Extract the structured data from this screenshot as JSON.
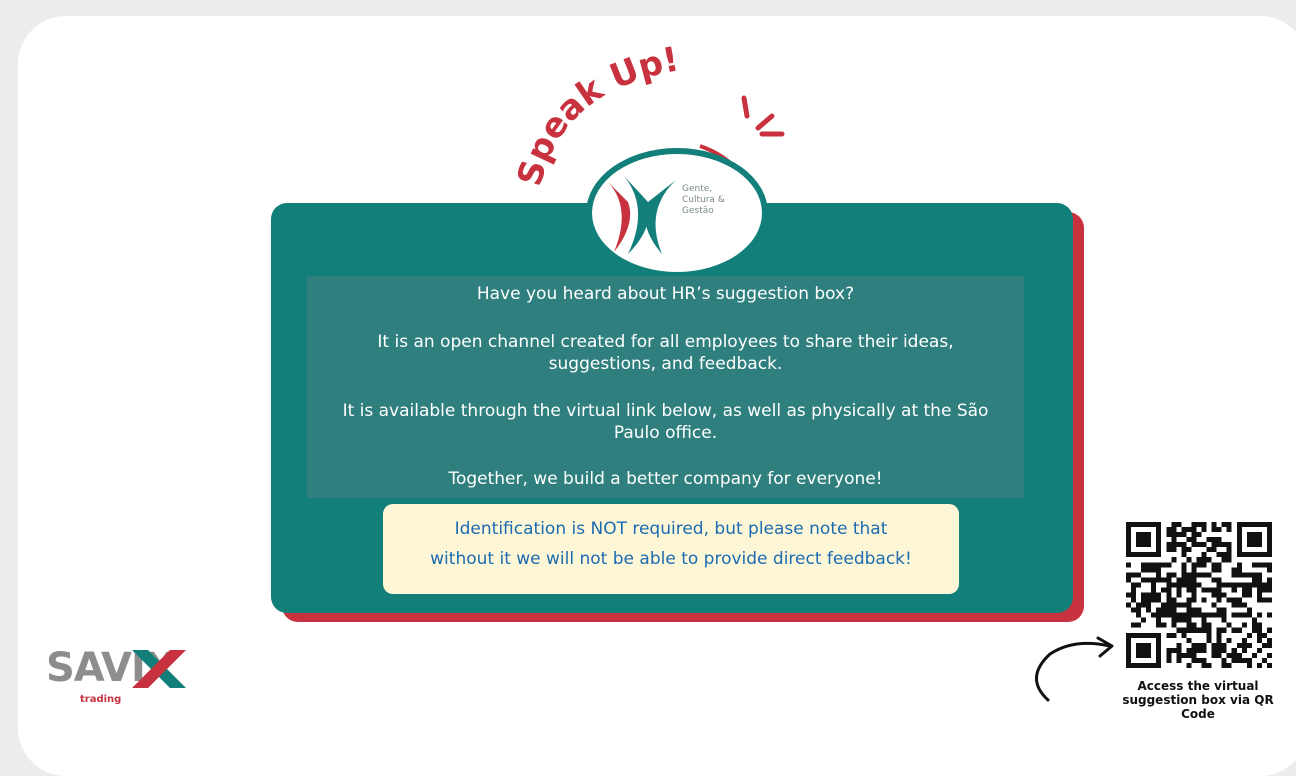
{
  "headline": "Speak Up!",
  "logo": {
    "line1": "Gente,",
    "line2": "Cultura &",
    "line3": "Gestão"
  },
  "message": {
    "p1": "Have you heard about HR’s suggestion box?",
    "p2": "It is an open channel created for all employees to share their ideas, suggestions, and feedback.",
    "p3": "It is available through the virtual link below, as well as physically at the São Paulo office.",
    "p4": "Together, we build a better company for everyone!"
  },
  "notice": {
    "line1": "Identification is NOT required, but please note that",
    "line2": "without it we will not be able to provide direct feedback!"
  },
  "brand": {
    "name": "SAVIX",
    "sub": "trading"
  },
  "qr": {
    "caption": "Access the virtual suggestion box via QR Code"
  },
  "colors": {
    "teal": "#137f7b",
    "red": "#c8323e",
    "cream": "#fdf7d8",
    "blue": "#1c6bb0"
  }
}
